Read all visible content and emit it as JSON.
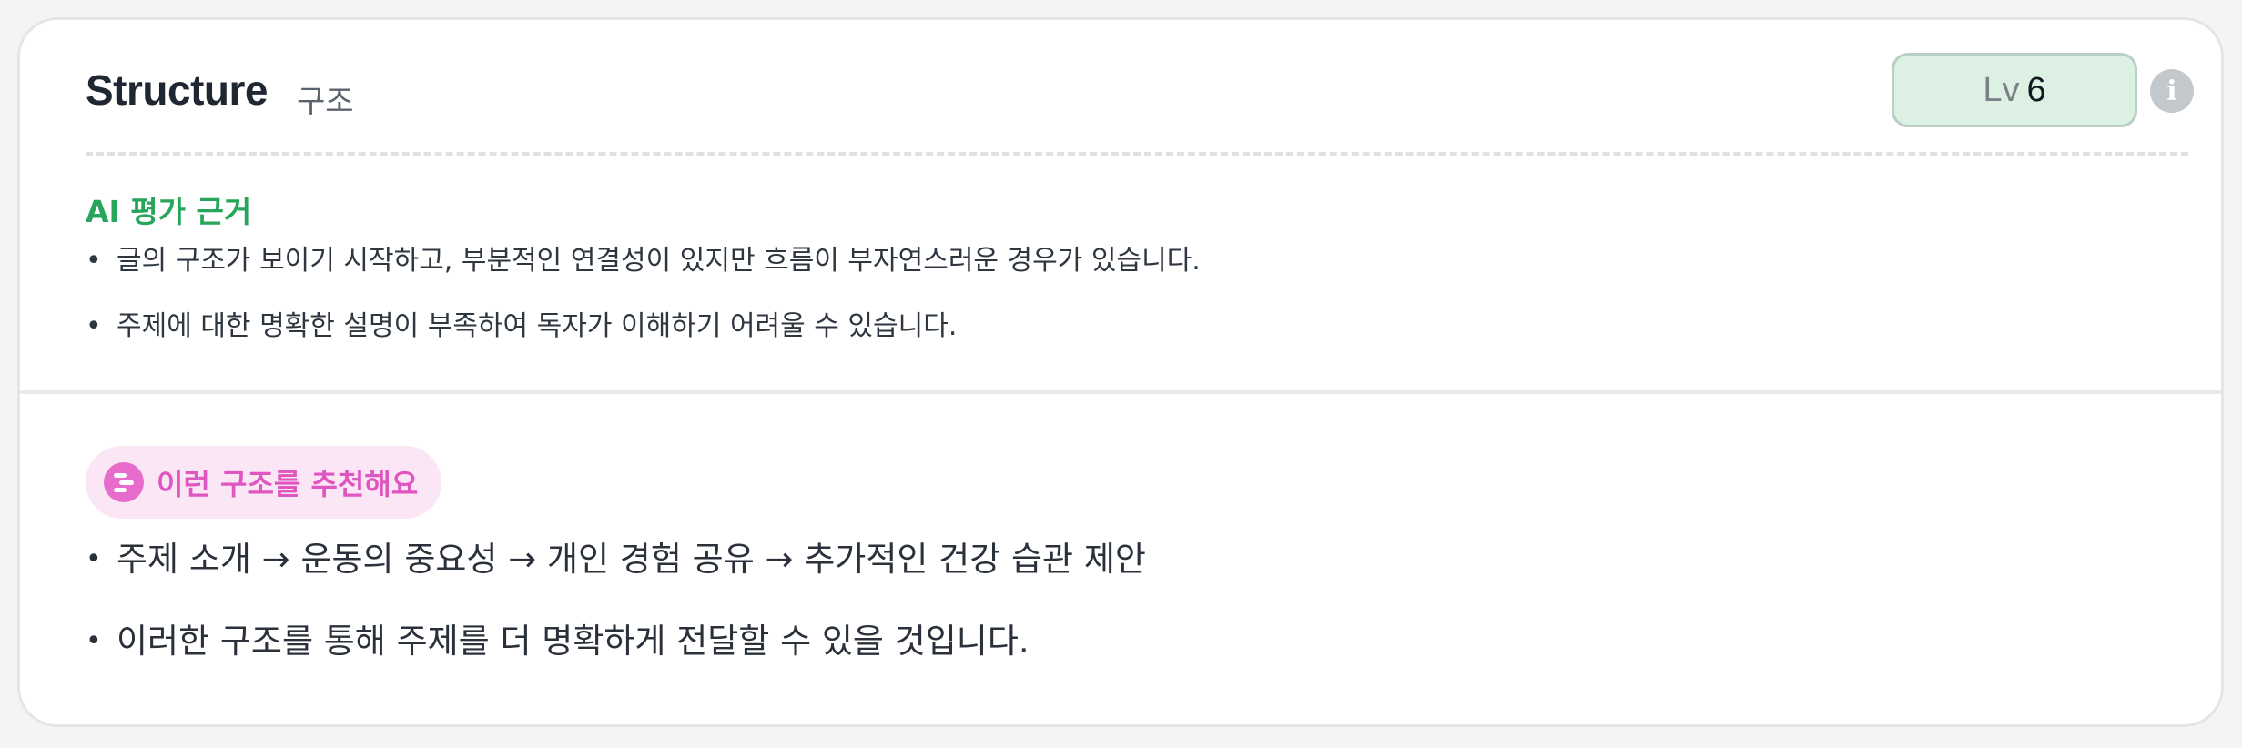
{
  "header": {
    "title": "Structure",
    "subtitle": "구조",
    "level_prefix": "Lv",
    "level_value": "6",
    "info_icon_glyph": "i"
  },
  "rationale": {
    "title": "AI 평가 근거",
    "items": [
      "글의 구조가 보이기 시작하고, 부분적인 연결성이 있지만 흐름이 부자연스러운 경우가 있습니다.",
      "주제에 대한 명확한 설명이 부족하여 독자가 이해하기 어려울 수 있습니다."
    ]
  },
  "recommendation": {
    "chip_label": "이런 구조를 추천해요",
    "items": [
      "주제 소개 → 운동의 중요성 → 개인 경험 공유 → 추가적인 건강 습관 제안",
      "이러한 구조를 통해 주제를 더 명확하게 전달할 수 있을 것입니다."
    ]
  },
  "colors": {
    "accent_green": "#27a55a",
    "badge_background": "#dcf0e4",
    "chip_background": "#fbe6f6",
    "chip_text": "#e056c1"
  },
  "icons": {
    "info": "info-icon",
    "structure": "structure-icon"
  }
}
